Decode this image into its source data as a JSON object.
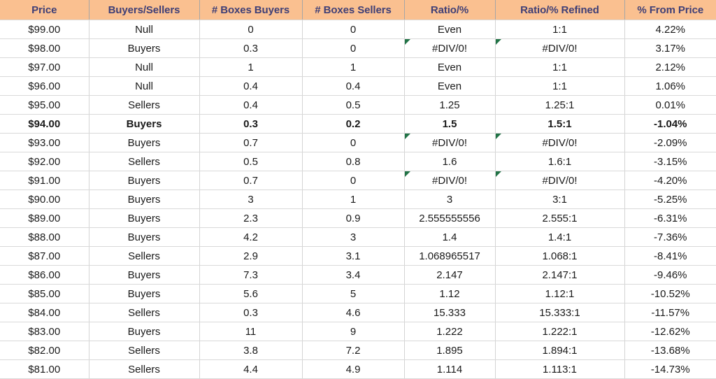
{
  "table": {
    "columns": [
      "Price",
      "Buyers/Sellers",
      "# Boxes Buyers",
      "# Boxes Sellers",
      "Ratio/%",
      "Ratio/% Refined",
      "% From Price"
    ],
    "colors": {
      "header_fill": "#FAC090",
      "header_text": "#3F3F76",
      "buyers_fill": "#C6EFCE",
      "buyers_text": "#1E6C28",
      "sellers_fill": "#FFC7CE",
      "sellers_text": "#BF1A2F",
      "null_fill": "#FFEB9C",
      "null_text": "#9C6500",
      "error_flag": "#217346",
      "grid_line": "#D9D9D9"
    },
    "rows": [
      {
        "price": "$99.00",
        "signal": "Null",
        "boxes_buyers": "0",
        "boxes_sellers": "0",
        "ratio": "Even",
        "ratio_refined": "1:1",
        "pct_from_price": "4.22%",
        "bold": false,
        "error_flag_ratio": false,
        "error_flag_refined": false
      },
      {
        "price": "$98.00",
        "signal": "Buyers",
        "boxes_buyers": "0.3",
        "boxes_sellers": "0",
        "ratio": "#DIV/0!",
        "ratio_refined": "#DIV/0!",
        "pct_from_price": "3.17%",
        "bold": false,
        "error_flag_ratio": true,
        "error_flag_refined": true
      },
      {
        "price": "$97.00",
        "signal": "Null",
        "boxes_buyers": "1",
        "boxes_sellers": "1",
        "ratio": "Even",
        "ratio_refined": "1:1",
        "pct_from_price": "2.12%",
        "bold": false,
        "error_flag_ratio": false,
        "error_flag_refined": false
      },
      {
        "price": "$96.00",
        "signal": "Null",
        "boxes_buyers": "0.4",
        "boxes_sellers": "0.4",
        "ratio": "Even",
        "ratio_refined": "1:1",
        "pct_from_price": "1.06%",
        "bold": false,
        "error_flag_ratio": false,
        "error_flag_refined": false
      },
      {
        "price": "$95.00",
        "signal": "Sellers",
        "boxes_buyers": "0.4",
        "boxes_sellers": "0.5",
        "ratio": "1.25",
        "ratio_refined": "1.25:1",
        "pct_from_price": "0.01%",
        "bold": false,
        "error_flag_ratio": false,
        "error_flag_refined": false
      },
      {
        "price": "$94.00",
        "signal": "Buyers",
        "boxes_buyers": "0.3",
        "boxes_sellers": "0.2",
        "ratio": "1.5",
        "ratio_refined": "1.5:1",
        "pct_from_price": "-1.04%",
        "bold": true,
        "error_flag_ratio": false,
        "error_flag_refined": false
      },
      {
        "price": "$93.00",
        "signal": "Buyers",
        "boxes_buyers": "0.7",
        "boxes_sellers": "0",
        "ratio": "#DIV/0!",
        "ratio_refined": "#DIV/0!",
        "pct_from_price": "-2.09%",
        "bold": false,
        "error_flag_ratio": true,
        "error_flag_refined": true
      },
      {
        "price": "$92.00",
        "signal": "Sellers",
        "boxes_buyers": "0.5",
        "boxes_sellers": "0.8",
        "ratio": "1.6",
        "ratio_refined": "1.6:1",
        "pct_from_price": "-3.15%",
        "bold": false,
        "error_flag_ratio": false,
        "error_flag_refined": false
      },
      {
        "price": "$91.00",
        "signal": "Buyers",
        "boxes_buyers": "0.7",
        "boxes_sellers": "0",
        "ratio": "#DIV/0!",
        "ratio_refined": "#DIV/0!",
        "pct_from_price": "-4.20%",
        "bold": false,
        "error_flag_ratio": true,
        "error_flag_refined": true
      },
      {
        "price": "$90.00",
        "signal": "Buyers",
        "boxes_buyers": "3",
        "boxes_sellers": "1",
        "ratio": "3",
        "ratio_refined": "3:1",
        "pct_from_price": "-5.25%",
        "bold": false,
        "error_flag_ratio": false,
        "error_flag_refined": false
      },
      {
        "price": "$89.00",
        "signal": "Buyers",
        "boxes_buyers": "2.3",
        "boxes_sellers": "0.9",
        "ratio": "2.555555556",
        "ratio_refined": "2.555:1",
        "pct_from_price": "-6.31%",
        "bold": false,
        "error_flag_ratio": false,
        "error_flag_refined": false
      },
      {
        "price": "$88.00",
        "signal": "Buyers",
        "boxes_buyers": "4.2",
        "boxes_sellers": "3",
        "ratio": "1.4",
        "ratio_refined": "1.4:1",
        "pct_from_price": "-7.36%",
        "bold": false,
        "error_flag_ratio": false,
        "error_flag_refined": false
      },
      {
        "price": "$87.00",
        "signal": "Sellers",
        "boxes_buyers": "2.9",
        "boxes_sellers": "3.1",
        "ratio": "1.068965517",
        "ratio_refined": "1.068:1",
        "pct_from_price": "-8.41%",
        "bold": false,
        "error_flag_ratio": false,
        "error_flag_refined": false
      },
      {
        "price": "$86.00",
        "signal": "Buyers",
        "boxes_buyers": "7.3",
        "boxes_sellers": "3.4",
        "ratio": "2.147",
        "ratio_refined": "2.147:1",
        "pct_from_price": "-9.46%",
        "bold": false,
        "error_flag_ratio": false,
        "error_flag_refined": false
      },
      {
        "price": "$85.00",
        "signal": "Buyers",
        "boxes_buyers": "5.6",
        "boxes_sellers": "5",
        "ratio": "1.12",
        "ratio_refined": "1.12:1",
        "pct_from_price": "-10.52%",
        "bold": false,
        "error_flag_ratio": false,
        "error_flag_refined": false
      },
      {
        "price": "$84.00",
        "signal": "Sellers",
        "boxes_buyers": "0.3",
        "boxes_sellers": "4.6",
        "ratio": "15.333",
        "ratio_refined": "15.333:1",
        "pct_from_price": "-11.57%",
        "bold": false,
        "error_flag_ratio": false,
        "error_flag_refined": false
      },
      {
        "price": "$83.00",
        "signal": "Buyers",
        "boxes_buyers": "11",
        "boxes_sellers": "9",
        "ratio": "1.222",
        "ratio_refined": "1.222:1",
        "pct_from_price": "-12.62%",
        "bold": false,
        "error_flag_ratio": false,
        "error_flag_refined": false
      },
      {
        "price": "$82.00",
        "signal": "Sellers",
        "boxes_buyers": "3.8",
        "boxes_sellers": "7.2",
        "ratio": "1.895",
        "ratio_refined": "1.894:1",
        "pct_from_price": "-13.68%",
        "bold": false,
        "error_flag_ratio": false,
        "error_flag_refined": false
      },
      {
        "price": "$81.00",
        "signal": "Sellers",
        "boxes_buyers": "4.4",
        "boxes_sellers": "4.9",
        "ratio": "1.114",
        "ratio_refined": "1.113:1",
        "pct_from_price": "-14.73%",
        "bold": false,
        "error_flag_ratio": false,
        "error_flag_refined": false
      }
    ]
  }
}
